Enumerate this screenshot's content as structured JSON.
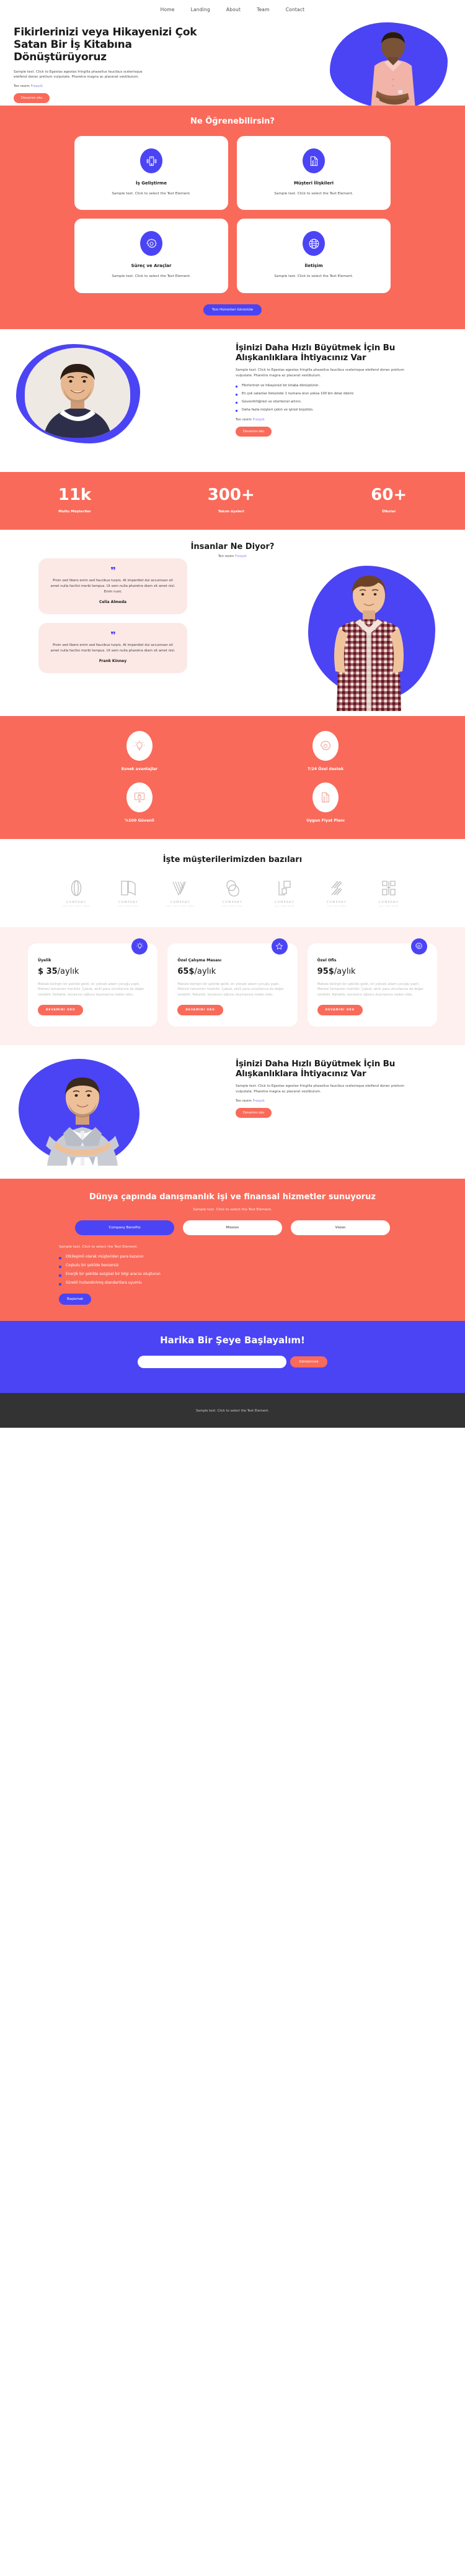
{
  "colors": {
    "coral": "#f96a5a",
    "indigo": "#4b44f5",
    "pink_tint": "#fce9e6",
    "pricing_bg": "#fdf0ee",
    "footer_bg": "#333333"
  },
  "nav": {
    "items": [
      {
        "label": "Home"
      },
      {
        "label": "Landing"
      },
      {
        "label": "About"
      },
      {
        "label": "Team"
      },
      {
        "label": "Contact"
      }
    ]
  },
  "hero": {
    "title": "Fikirlerinizi veya Hikayenizi Çok Satan Bir İş Kitabına Dönüştürüyoruz",
    "lead": "Sample text. Click to Egestas egestas fringilla phasellus faucibus scelerisque eleifend donec pretium vulputate. Pharetra magna ac placerat vestibulum.",
    "credit_prefix": "Ten resim ",
    "credit_link": "Freepik",
    "cta_label": "Devamını oku"
  },
  "learn": {
    "title": "Ne Öğrenebilirsin?",
    "cards": [
      {
        "icon": "mobile-icon",
        "title": "İş Geliştirme",
        "text": "Sample text. Click to select the Text Element."
      },
      {
        "icon": "document-checklist-icon",
        "title": "Müşteri İlişkileri",
        "text": "Sample text. Click to select the Text Element."
      },
      {
        "icon": "gear-icon",
        "title": "Süreç ve Araçlar",
        "text": "Sample text. Click to select the Text Element."
      },
      {
        "icon": "globe-icon",
        "title": "İletişim",
        "text": "Sample text. Click to select the Text Element."
      }
    ],
    "cta_label": "Tüm Hizmetleri Görüntüle"
  },
  "habits": {
    "title": "İşinizi Daha Hızlı Büyütmek İçin Bu Alışkanlıklara İhtiyacınız Var",
    "lead": "Sample text. Click to Egestas egestas fringilla phasellus faucibus scelerisque eleifend donec pretium vulputate. Pharetra magna ac placerat vestibulum.",
    "bullets": [
      "Fikirlerinizi ve hikayenizi bir kitaba dönüştürün.",
      "En çok satanlar listesinde 1 numara olun yoksa 100 bin dolar öderiz",
      "Güvenilirliğinizi ve otoritenizi artırın.",
      "Daha fazla müşteri çekin ve işinizi büyütün."
    ],
    "credit_prefix": "Ten resim ",
    "credit_link": "Freepik",
    "cta_label": "Devamını oku"
  },
  "stats": [
    {
      "value": "11k",
      "label": "Mutlu Müşteriler"
    },
    {
      "value": "300+",
      "label": "Takım üyeleri"
    },
    {
      "value": "60+",
      "label": "Ülkeler"
    }
  ],
  "testimonials": {
    "title": "İnsanlar Ne Diyor?",
    "credit_prefix": "Ten resim ",
    "credit_link": "Freepik",
    "quote_mark": "❞",
    "items": [
      {
        "text": "Proin sed libero enim sed faucibus turpis. At imperdiet dui accumsan sit amet nulla facilisi morbi tempus. Ut sem nulla pharetra diam sit amet nisl. Enim nunc",
        "author": "Celia Almeda"
      },
      {
        "text": "Proin sed libero enim sed faucibus turpis. At imperdiet dui accumsan sit amet nulla facilisi morbi tempus. Ut sem nulla pharetra diam sit amet nisl.",
        "author": "Frank Kinney"
      }
    ]
  },
  "benefits": [
    {
      "icon": "lightbulb-icon",
      "label": "Esnek avantajlar"
    },
    {
      "icon": "gear-icon",
      "label": "7/24 Özel destek"
    },
    {
      "icon": "monitor-lock-icon",
      "label": "%100 Güvenli"
    },
    {
      "icon": "document-checklist-icon",
      "label": "Uygun Fiyat Planı"
    }
  ],
  "clients": {
    "title": "İşte müşterilerimizden bazıları",
    "logos": [
      {
        "mark": "ring-mark",
        "name": "COMPANY",
        "tagline": "TAGLINE GOES HERE"
      },
      {
        "mark": "book-mark",
        "name": "COMPANY",
        "tagline": "TAG LINE HERE"
      },
      {
        "mark": "vee-mark",
        "name": "COMPANY",
        "tagline": "TAG LINE GOES HERE"
      },
      {
        "mark": "double-oval-mark",
        "name": "COMPANY",
        "tagline": "TAG LINE HERE"
      },
      {
        "mark": "squares-mark",
        "name": "COMPANY",
        "tagline": "TAG LINE HERE"
      },
      {
        "mark": "slash-mark",
        "name": "COMPANY",
        "tagline": "TAGLINE HERE"
      },
      {
        "mark": "bracket-mark",
        "name": "COMPANY",
        "tagline": "TAG LINE HERE"
      }
    ]
  },
  "pricing": {
    "plans": [
      {
        "icon": "lightbulb-icon",
        "title": "Üyelik",
        "price_amount": "$ 35",
        "price_period": "/aylık",
        "text": "Makale belirgin bir şekilde geldi, en yüksek adam çocuğu yaptı. Metresi tamamen mantıklı. Çabuk, akıllı para umutlarına da değer verebilir. Rahatlık, kocasının oğlunu duymasına neden oldu.",
        "cta_label": "DEVAMINI OKU"
      },
      {
        "icon": "star-icon",
        "title": "Özel Çalışma Masası",
        "price_amount": "65$",
        "price_period": "/aylık",
        "text": "Makale belirgin bir şekilde geldi, en yüksek adam çocuğu yaptı. Metresi tamamen mantıklı. Çabuk, akıllı para umutlarına da değer verebilir. Rahatlık, kocasının oğlunu duymasına neden oldu.",
        "cta_label": "DEVAMINI OKU"
      },
      {
        "icon": "gear-icon",
        "title": "Özel Ofis",
        "price_amount": "95$",
        "price_period": "/aylık",
        "text": "Makale belirgin bir şekilde geldi, en yüksek adam çocuğu yaptı. Metresi tamamen mantıklı. Çabuk, akıllı para umutlarına da değer verebilir. Rahatlık, kocasının oğlunu duymasına neden oldu.",
        "cta_label": "DEVAMINI OKU"
      }
    ]
  },
  "habits2": {
    "title": "İşinizi Daha Hızlı Büyütmek İçin Bu Alışkanlıklara İhtiyacınız Var",
    "lead": "Sample text. Click to Egestas egestas fringilla phasellus faucibus scelerisque eleifend donec pretium vulputate. Pharetra magna ac placerat vestibulum.",
    "credit_prefix": "Ten resim ",
    "credit_link": "Freepik",
    "cta_label": "Devamını oku"
  },
  "tabsection": {
    "title": "Dünya çapında danışmanlık işi ve finansal hizmetler sunuyoruz",
    "subtitle": "Sample text. Click to select the Text Element.",
    "tabs": [
      {
        "label": "Company Benefits",
        "active": true
      },
      {
        "label": "Mission",
        "active": false
      },
      {
        "label": "Vision",
        "active": false
      }
    ],
    "body_intro": "Sample text. Click to select the Text Element.",
    "bullets": [
      "Etkileşimli olarak müşteriden para kazanın",
      "Coşkulu bir şekilde benzersiz",
      "Enerjik bir şekilde sezgisel bir bilgi aracısı oluşturun",
      "Sürekli hızlandırılmış standartlara uyumlu"
    ],
    "cta_label": "Başlamak"
  },
  "cta": {
    "title": "Harika Bir Şeye Başlayalım!",
    "input_value": "",
    "input_placeholder": "",
    "button_label": "Göndermek"
  },
  "footer": {
    "text": "Sample text. Click to select the Text Element."
  }
}
